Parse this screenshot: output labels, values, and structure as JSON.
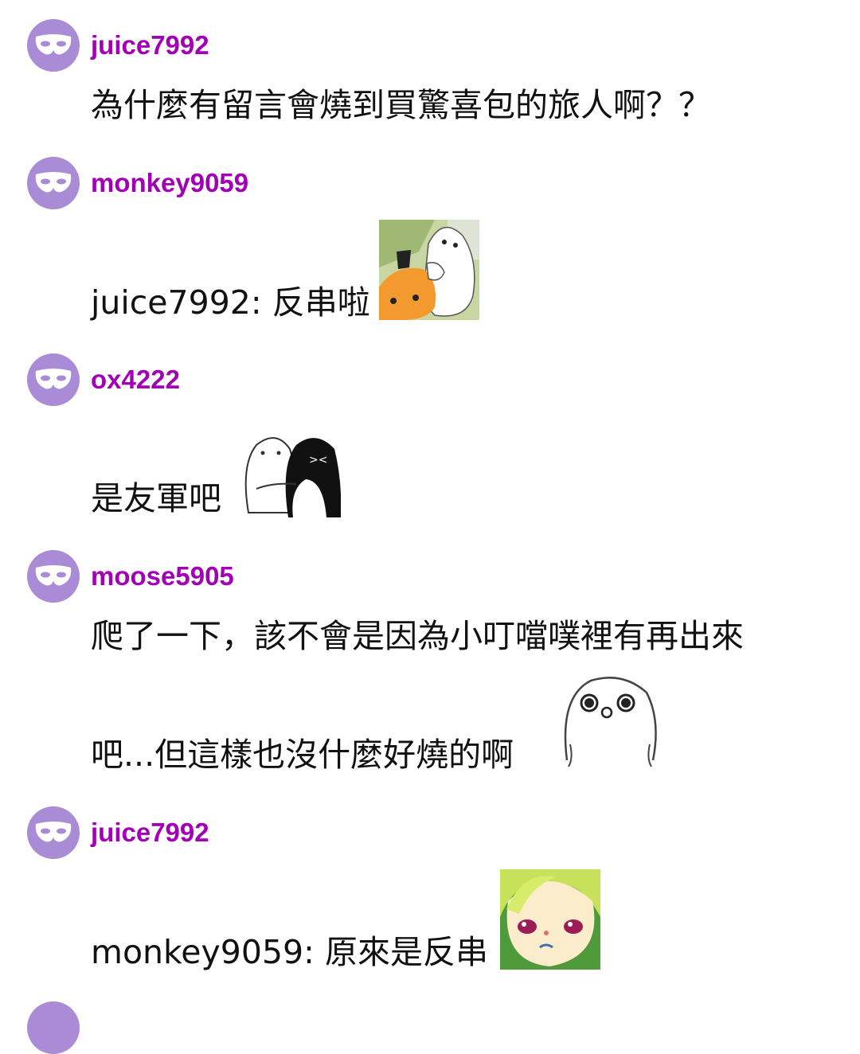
{
  "comments": [
    {
      "username": "juice7992",
      "lines": [
        "為什麼有留言會燒到買驚喜包的旅人啊？？"
      ],
      "avatar_icon": "mask-icon"
    },
    {
      "username": "monkey9059",
      "lines": [
        "juice7992: 反串啦"
      ],
      "sticker": "seal-hugging-orange-sticker",
      "avatar_icon": "mask-icon"
    },
    {
      "username": "ox4222",
      "lines": [
        "是友軍吧"
      ],
      "sticker": "seal-and-penguin-hug-sticker",
      "avatar_icon": "mask-icon"
    },
    {
      "username": "moose5905",
      "lines": [
        "爬了一下，該不會是因為小叮噹噗裡有再出來",
        "吧...但這樣也沒什麼好燒的啊"
      ],
      "sticker": "shocked-white-blob-sticker",
      "avatar_icon": "mask-icon"
    },
    {
      "username": "juice7992",
      "lines": [
        "monkey9059: 原來是反串"
      ],
      "sticker": "green-haired-face-sticker",
      "avatar_icon": "mask-icon"
    }
  ],
  "colors": {
    "username": "#a200b5",
    "avatar_bg": "#a98bd6",
    "text": "#111111",
    "background": "#ffffff"
  }
}
